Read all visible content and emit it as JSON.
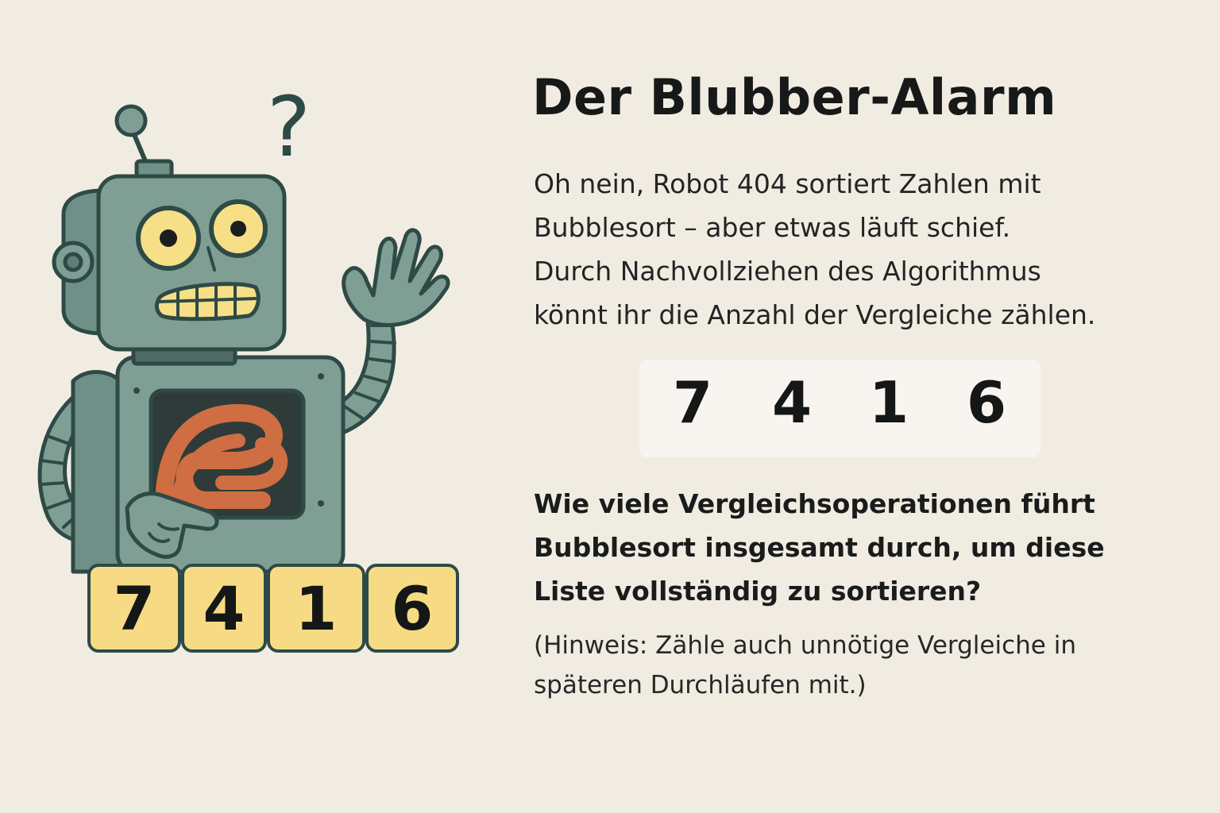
{
  "title": "Der Blubber-Alarm",
  "intro": {
    "lines": [
      "Oh nein, Robot 404 sortiert Zahlen mit",
      "Bubblesort – aber etwas läuft schief.",
      "Durch Nachvollziehen des Algorithmus",
      "könnt ihr die Anzahl der Vergleiche zählen."
    ]
  },
  "numbers": [
    "7",
    "4",
    "1",
    "6"
  ],
  "question": {
    "lines": [
      "Wie viele Vergleichsoperationen führt",
      "Bubblesort insgesamt durch, um diese",
      "Liste vollständig zu sortieren?"
    ]
  },
  "hint": {
    "lines": [
      "(Hinweis: Zähle auch unnötige Vergleiche in",
      "späteren Durchläufen mit.)"
    ]
  },
  "illustration": {
    "question_mark": "?",
    "colors": {
      "background": "#f1ece2",
      "robot_body": "#7f9f95",
      "robot_dark": "#5f7f76",
      "outline": "#2e4a46",
      "eyes": "#f7df87",
      "wires": "#cf6e43",
      "tile_fill": "#f7db84"
    }
  }
}
